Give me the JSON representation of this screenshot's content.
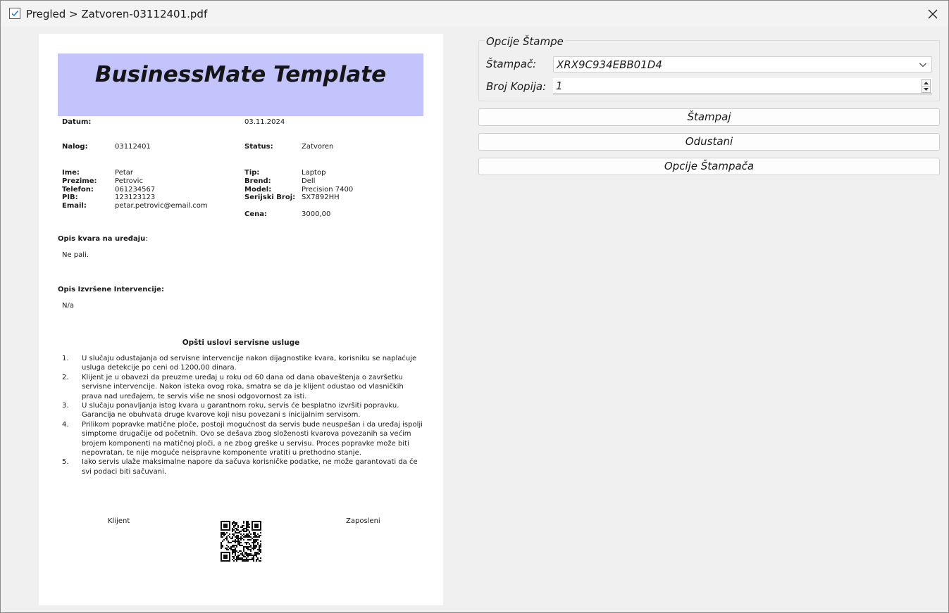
{
  "window": {
    "title": "Pregled > Zatvoren-03112401.pdf",
    "icon": "checkbox-document-icon",
    "close_icon": "close-icon"
  },
  "document": {
    "banner_title": "BusinessMate Template",
    "banner_color": "#c4c4fc",
    "datum_label": "Datum:",
    "datum_value": "03.11.2024",
    "nalog_label": "Nalog:",
    "nalog_value": "03112401",
    "status_label": "Status:",
    "status_value": "Zatvoren",
    "client": {
      "ime_label": "Ime:",
      "ime_value": "Petar",
      "prezime_label": "Prezime:",
      "prezime_value": "Petrovic",
      "telefon_label": "Telefon:",
      "telefon_value": "061234567",
      "pib_label": "PIB:",
      "pib_value": "123123123",
      "email_label": "Email:",
      "email_value": "petar.petrovic@email.com"
    },
    "device": {
      "tip_label": "Tip:",
      "tip_value": "Laptop",
      "brend_label": "Brend:",
      "brend_value": "Dell",
      "model_label": "Model:",
      "model_value": "Precision 7400",
      "serijski_label": "Serijski Broj:",
      "serijski_value": "SX7892HH",
      "cena_label": "Cena:",
      "cena_value": "3000,00"
    },
    "opis_kvara_label": "Opis kvara na uređaju",
    "opis_kvara_colon": ":",
    "opis_kvara_value": "Ne pali.",
    "opis_intervencije_label": "Opis Izvršene Intervencije:",
    "opis_intervencije_value": "N/a",
    "terms_title": "Opšti uslovi servisne usluge",
    "terms": [
      {
        "num": "1.",
        "text": "U slučaju odustajanja od servisne intervencije nakon dijagnostike kvara, korisniku se naplaćuje usluga detekcije po ceni od 1200,00 dinara."
      },
      {
        "num": "2.",
        "text": "Klijent je u obavezi da preuzme uređaj u roku od 60 dana od dana obaveštenja o završetku servisne intervencije. Nakon isteka ovog roka, smatra se da je klijent odustao od vlasničkih prava nad uređajem, te servis više ne snosi odgovornost za isti."
      },
      {
        "num": "3.",
        "text": "U slučaju ponavljanja istog kvara u garantnom roku, servis će besplatno izvršiti popravku. Garancija ne obuhvata druge kvarove koji nisu povezani s inicijalnim servisom."
      },
      {
        "num": "4.",
        "text": "Prilikom popravke matične ploče, postoji mogućnost da servis bude neuspešan i da uređaj ispolji simptome drugačije od početnih. Ovo se dešava zbog složenosti kvarova povezanih sa većim brojem komponenti na matičnoj ploči, a ne zbog greške u servisu. Proces popravke može biti nepovratan, te nije moguće neispravne komponente vratiti u prethodno stanje."
      },
      {
        "num": "5.",
        "text": "Iako servis ulaže maksimalne napore da sačuva korisničke podatke, ne može garantovati da će svi podaci biti sačuvani."
      }
    ],
    "klijent_label": "Klijent",
    "zaposleni_label": "Zaposleni",
    "qr_icon": "qr-code-icon"
  },
  "print_options": {
    "group_title": "Opcije Štampe",
    "printer_label": "Štampač:",
    "printer_value": "XRX9C934EBB01D4",
    "copies_label": "Broj Kopija:",
    "copies_value": "1"
  },
  "buttons": {
    "print": "Štampaj",
    "cancel": "Odustani",
    "printer_options": "Opcije Štampača"
  }
}
